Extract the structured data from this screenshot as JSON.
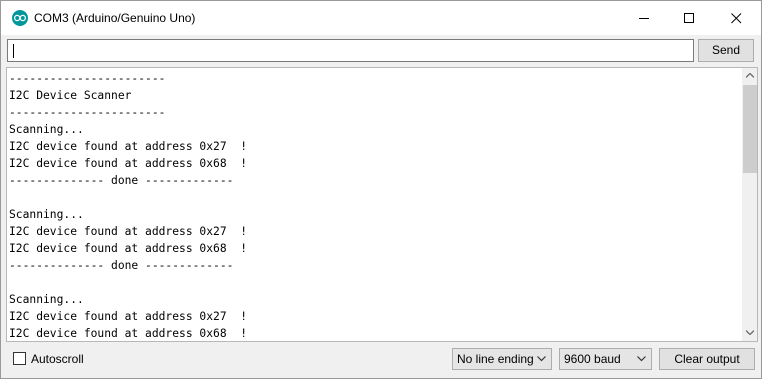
{
  "window": {
    "title": "COM3 (Arduino/Genuino Uno)",
    "icon": "arduino-logo-icon"
  },
  "input": {
    "value": "",
    "send_label": "Send"
  },
  "output_lines": [
    "-----------------------",
    "I2C Device Scanner",
    "-----------------------",
    "Scanning...",
    "I2C device found at address 0x27  !",
    "I2C device found at address 0x68  !",
    "-------------- done -------------",
    "",
    "Scanning...",
    "I2C device found at address 0x27  !",
    "I2C device found at address 0x68  !",
    "-------------- done -------------",
    "",
    "Scanning...",
    "I2C device found at address 0x27  !",
    "I2C device found at address 0x68  !"
  ],
  "footer": {
    "autoscroll_label": "Autoscroll",
    "autoscroll_checked": false,
    "line_ending_selected": "No line ending",
    "baud_selected": "9600 baud",
    "clear_label": "Clear output"
  },
  "colors": {
    "arduino_teal": "#00979c"
  }
}
